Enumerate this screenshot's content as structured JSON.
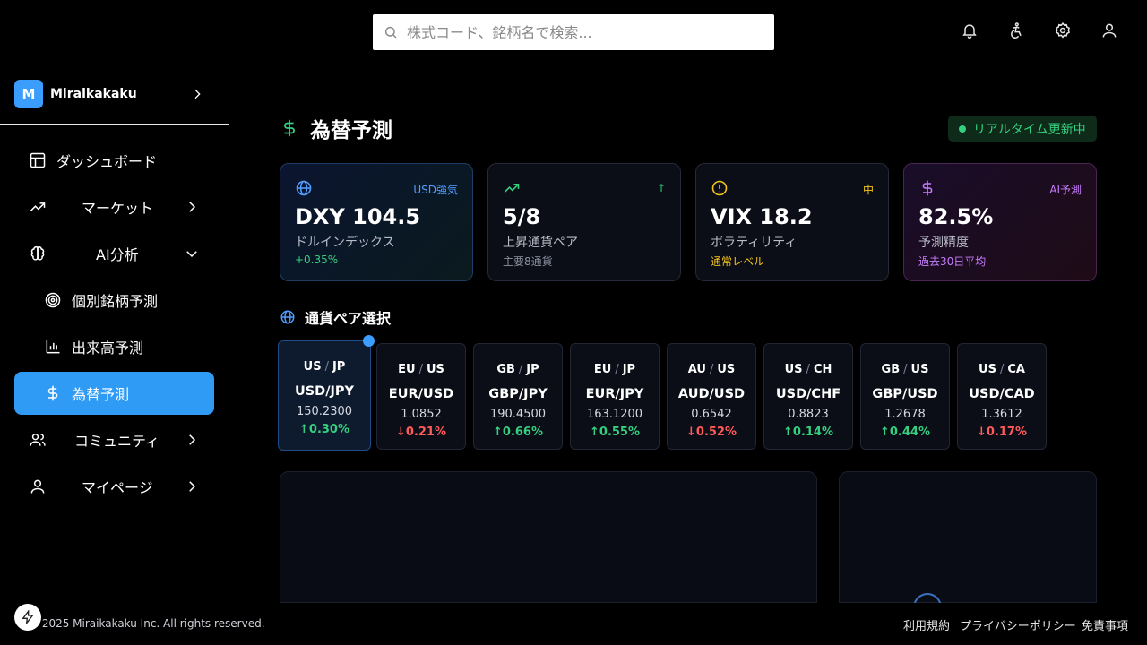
{
  "search": {
    "placeholder": "株式コード、銘柄名で検索..."
  },
  "topbar": {
    "icons": [
      "bell-icon",
      "accessibility-icon",
      "gear-icon",
      "user-icon"
    ]
  },
  "brand": {
    "logo_letter": "M",
    "name": "Miraikakaku"
  },
  "sidebar": {
    "items": [
      {
        "label": "ダッシュボード",
        "icon": "layout-icon"
      },
      {
        "label": "マーケット",
        "icon": "trending-up-icon"
      },
      {
        "label": "AI分析",
        "icon": "brain-icon"
      },
      {
        "label": "個別銘柄予測",
        "icon": "target-icon"
      },
      {
        "label": "出来高予測",
        "icon": "bar-chart-icon"
      },
      {
        "label": "為替予測",
        "icon": "dollar-icon"
      },
      {
        "label": "コミュニティ",
        "icon": "users-icon"
      },
      {
        "label": "マイページ",
        "icon": "user-icon"
      }
    ]
  },
  "page": {
    "title": "為替予測",
    "live_badge": "リアルタイム更新中"
  },
  "cards": [
    {
      "badge": "USD強気",
      "value": "DXY 104.5",
      "label": "ドルインデックス",
      "sub": "+0.35%",
      "accent": "#4f9dff"
    },
    {
      "badge": "↑",
      "value": "5/8",
      "label": "上昇通貨ペア",
      "sub": "主要8通貨",
      "accent": "#35d07f"
    },
    {
      "badge": "中",
      "value": "VIX 18.2",
      "label": "ボラティリティ",
      "sub": "通常レベル",
      "accent": "#f5c518"
    },
    {
      "badge": "AI予測",
      "value": "82.5%",
      "label": "予測精度",
      "sub": "過去30日平均",
      "accent": "#c77dff"
    }
  ],
  "section": {
    "title": "通貨ペア選択"
  },
  "pairs": [
    {
      "base": "US",
      "quote": "JP",
      "slash": "/",
      "name": "USD/JPY",
      "rate": "150.2300",
      "change": "↑0.30%",
      "dir": "up"
    },
    {
      "base": "EU",
      "quote": "US",
      "slash": "/",
      "name": "EUR/USD",
      "rate": "1.0852",
      "change": "↓0.21%",
      "dir": "down"
    },
    {
      "base": "GB",
      "quote": "JP",
      "slash": "/",
      "name": "GBP/JPY",
      "rate": "190.4500",
      "change": "↑0.66%",
      "dir": "up"
    },
    {
      "base": "EU",
      "quote": "JP",
      "slash": "/",
      "name": "EUR/JPY",
      "rate": "163.1200",
      "change": "↑0.55%",
      "dir": "up"
    },
    {
      "base": "AU",
      "quote": "US",
      "slash": "/",
      "name": "AUD/USD",
      "rate": "0.6542",
      "change": "↓0.52%",
      "dir": "down"
    },
    {
      "base": "US",
      "quote": "CH",
      "slash": "/",
      "name": "USD/CHF",
      "rate": "0.8823",
      "change": "↑0.14%",
      "dir": "up"
    },
    {
      "base": "GB",
      "quote": "US",
      "slash": "/",
      "name": "GBP/USD",
      "rate": "1.2678",
      "change": "↑0.44%",
      "dir": "up"
    },
    {
      "base": "US",
      "quote": "CA",
      "slash": "/",
      "name": "USD/CAD",
      "rate": "1.3612",
      "change": "↓0.17%",
      "dir": "down"
    }
  ],
  "footer": {
    "copyright": "2025 Miraikakaku Inc. All rights reserved.",
    "links": [
      "利用規約",
      "プライバシーポリシー",
      "免責事項"
    ]
  }
}
